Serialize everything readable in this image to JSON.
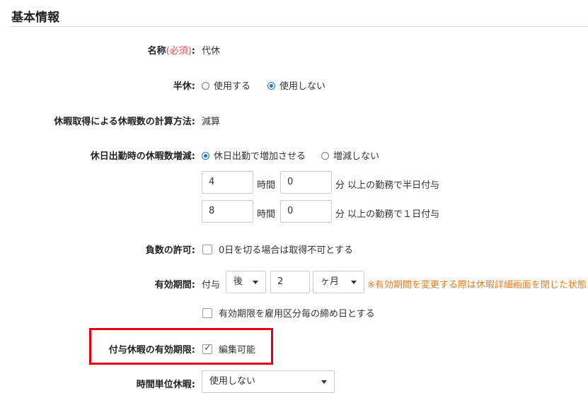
{
  "section": {
    "title": "基本情報"
  },
  "name": {
    "label": "名称",
    "required": "(必須)",
    "colon": ":",
    "value": "代休"
  },
  "half": {
    "label": "半休:",
    "option_use": "使用する",
    "option_nouse": "使用しない"
  },
  "calc": {
    "label": "休暇取得による休暇数の計算方法:",
    "value": "減算"
  },
  "holiday": {
    "label": "休日出勤時の休暇数増減:",
    "option_increase": "休日出勤で増加させる",
    "option_none": "増減しない",
    "row1": {
      "hours": "4",
      "hours_unit": "時間",
      "minutes": "0",
      "suffix": "分 以上の勤務で半日付与"
    },
    "row2": {
      "hours": "8",
      "hours_unit": "時間",
      "minutes": "0",
      "suffix": "分 以上の勤務で１日付与"
    }
  },
  "negative": {
    "label": "負数の許可:",
    "checkbox_label": "0日を切る場合は取得不可とする"
  },
  "validity": {
    "label": "有効期間:",
    "prefix": "付与",
    "when": "後",
    "amount": "2",
    "unit": "ヶ月",
    "warning": "※有効期間を変更する際は休暇詳細画面を閉じた状態",
    "checkbox_label": "有効期限を雇用区分毎の締め日とする"
  },
  "grant_validity": {
    "label": "付与休暇の有効期限:",
    "checkbox_label": "編集可能"
  },
  "hourly": {
    "label": "時間単位休暇:",
    "value": "使用しない"
  },
  "colors": {
    "accent": "#1e6fd9",
    "required": "#d9534f",
    "warning": "#e67e22",
    "highlight": "#e60012"
  }
}
